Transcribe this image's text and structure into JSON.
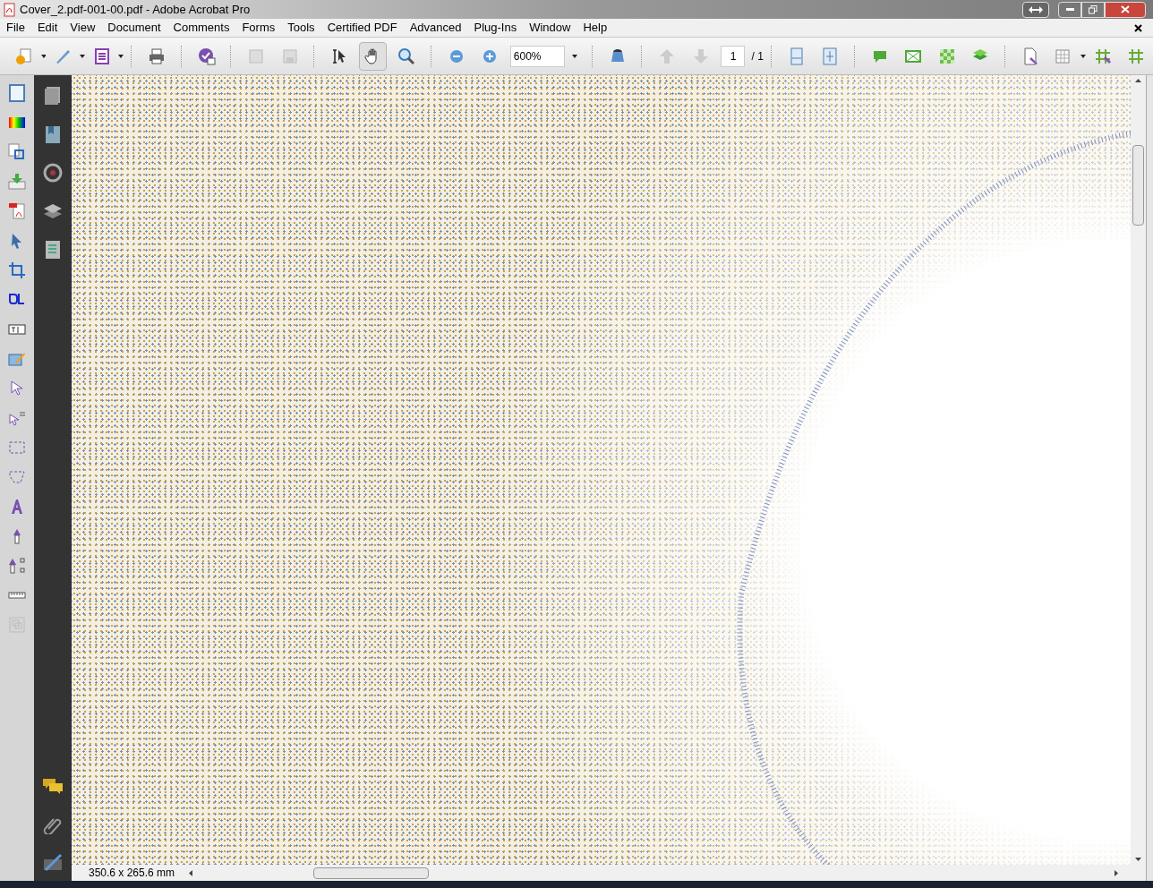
{
  "window": {
    "title": "Cover_2.pdf-001-00.pdf - Adobe Acrobat Pro"
  },
  "menu": [
    "File",
    "Edit",
    "View",
    "Document",
    "Comments",
    "Forms",
    "Tools",
    "Certified PDF",
    "Advanced",
    "Plug-Ins",
    "Window",
    "Help"
  ],
  "toolbar": {
    "hand_tool": {
      "selected": true
    },
    "select_tool": {
      "selected": false
    },
    "zoom": "600%",
    "page": "1",
    "page_total": "/ 1"
  },
  "status_bar": {
    "page_size": "350.6 x 265.6 mm"
  }
}
